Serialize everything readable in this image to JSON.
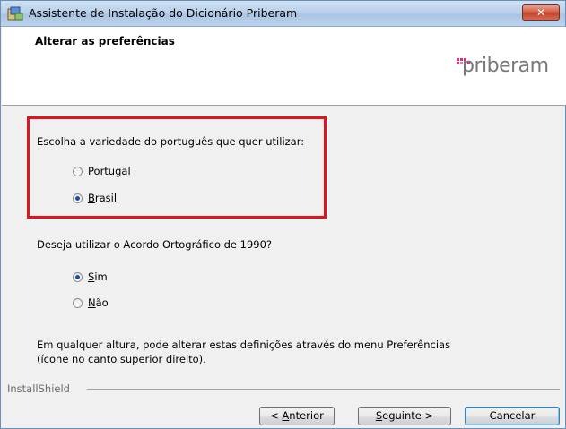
{
  "window": {
    "title": "Assistente de Instalação do Dicionário Priberam",
    "close_label": "✕"
  },
  "banner": {
    "title": "Alterar as preferências",
    "logo_text": "priberam"
  },
  "variety": {
    "question": "Escolha a variedade do português que quer utilizar:",
    "options": [
      {
        "access_key": "P",
        "rest": "ortugal",
        "selected": false
      },
      {
        "access_key": "B",
        "rest": "rasil",
        "selected": true
      }
    ]
  },
  "agreement": {
    "question": "Deseja utilizar o Acordo Ortográfico de 1990?",
    "options": [
      {
        "access_key": "S",
        "rest": "im",
        "selected": true
      },
      {
        "access_key": "N",
        "rest": "ão",
        "selected": false
      }
    ]
  },
  "note": {
    "line1": "Em qualquer altura, pode alterar estas definições através do menu Preferências",
    "line2": "(ícone no canto superior direito)."
  },
  "footer": {
    "brand": "InstallShield",
    "back_prefix": "< ",
    "back_key": "A",
    "back_rest": "nterior",
    "next_key": "S",
    "next_rest": "eguinte >",
    "cancel_label": "Cancelar"
  },
  "colors": {
    "highlight": "#e0141e",
    "radio_selected": "#1b4e9c"
  }
}
